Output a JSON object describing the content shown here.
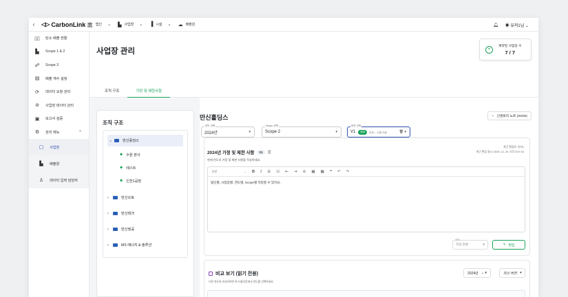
{
  "topbar": {
    "back_icon": "chevron-left-icon",
    "logo": "CarbonLink",
    "nav": [
      {
        "icon": "building-icon",
        "label": "법인"
      },
      {
        "icon": "factory-icon",
        "label": "사업장"
      },
      {
        "icon": "facility-icon",
        "label": "시설"
      },
      {
        "icon": "cloud-icon",
        "label": "배출원"
      }
    ],
    "user": "유저1님"
  },
  "sidebar": {
    "items": [
      {
        "icon": "dashboard-icon",
        "label": "탄소 배출 현황"
      },
      {
        "icon": "bar-chart-icon",
        "label": "Scope 1 & 2"
      },
      {
        "icon": "network-icon",
        "label": "Scope 3"
      },
      {
        "icon": "calculator-icon",
        "label": "배출 계수 설정"
      },
      {
        "icon": "upload-icon",
        "label": "데이터 요청 관리"
      },
      {
        "icon": "check-circle-icon",
        "label": "사업장 데이터 관리"
      },
      {
        "icon": "report-icon",
        "label": "보고서 검증"
      },
      {
        "icon": "gear-icon",
        "label": "관리 메뉴"
      }
    ],
    "sub_items": [
      {
        "icon": "document-icon",
        "label": "사업장"
      },
      {
        "icon": "factory-icon",
        "label": "배출원"
      },
      {
        "icon": "user-icon",
        "label": "데이터 입력 담당자"
      }
    ]
  },
  "page": {
    "title": "사업장 관리",
    "contract_label": "계약된 사업장 수",
    "contract_value": "7 / 7",
    "tabs": [
      "조직 구조",
      "가정 및 제한사항"
    ]
  },
  "org": {
    "title": "조직 구조",
    "root": "만신홀딩스",
    "leaves": [
      "수원 본사",
      "테스트",
      "인천1공장"
    ],
    "groups": [
      "만신오토",
      "만신테크",
      "만신정공",
      "MS 에너지 & 솔루션"
    ]
  },
  "panel": {
    "title": "만신홀딩스",
    "note_button": "인벤토리 노트 (85/85)",
    "year_label": "연도 선택",
    "year_value": "2024년",
    "scope_label": "Scope 선택",
    "scope_value": "Scope 2",
    "version_label": "버전 선택",
    "version_value": "V1",
    "version_badge": "현재",
    "version_note": "유저1 · 12월 20일",
    "card_title": "2024년 가정 및 제한 사항",
    "card_version": "V1",
    "card_sub": "현재 연도의 가정 및 제한 사항을 작성하세요.",
    "meta_editor": "최근 편집자: 유저1",
    "meta_time": "최근 편집 일시: 2025. 12. 20. 오후 5:57:16",
    "toolbar_para": "본문",
    "editor_text": "법인별, 사업장별, 연도별, Scope별 저장할 수 있어요.",
    "status_label": "상태",
    "status_value": "작성 완료",
    "edit_button": "편집",
    "compare_title": "비교 보기 (읽기 전용)",
    "compare_sub": "다른 연도와 비교하려면 위 드롭다운에서 연도를 선택하세요.",
    "compare_year": "2024년",
    "compare_version": "최신 버전"
  },
  "colors": {
    "accent": "#19a35a",
    "folder": "#2b5fb5"
  }
}
